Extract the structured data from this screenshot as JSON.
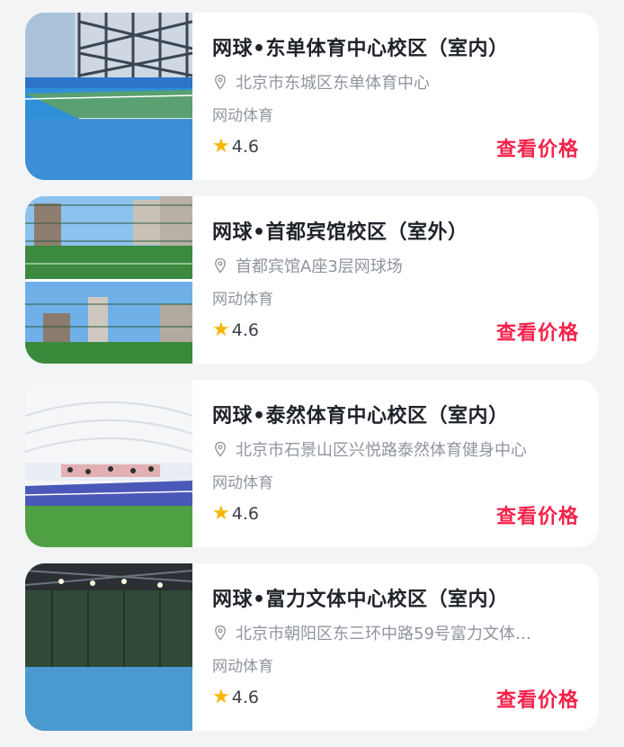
{
  "venues": [
    {
      "title": "网球•东单体育中心校区（室内）",
      "address": "北京市东城区东单体育中心",
      "brand": "网动体育",
      "rating": "4.6",
      "action": "查看价格",
      "image": "indoor-tennis-court-photo"
    },
    {
      "title": "网球•首都宾馆校区（室外）",
      "address": "首都宾馆A座3层网球场",
      "brand": "网动体育",
      "rating": "4.6",
      "action": "查看价格",
      "image": "rooftop-tennis-court-photo"
    },
    {
      "title": "网球•泰然体育中心校区（室内）",
      "address": "北京市石景山区兴悦路泰然体育健身中心",
      "brand": "网动体育",
      "rating": "4.6",
      "action": "查看价格",
      "image": "dome-tennis-court-photo"
    },
    {
      "title": "网球•富力文体中心校区（室内）",
      "address": "北京市朝阳区东三环中路59号富力文体…",
      "brand": "网动体育",
      "rating": "4.6",
      "action": "查看价格",
      "image": "indoor-hall-tennis-court-photo"
    }
  ],
  "icons": {
    "location": "location-pin-icon",
    "rating": "star-icon"
  },
  "colors": {
    "accent": "#f5224a",
    "star": "#f7b500",
    "background": "#f3f4f6"
  }
}
